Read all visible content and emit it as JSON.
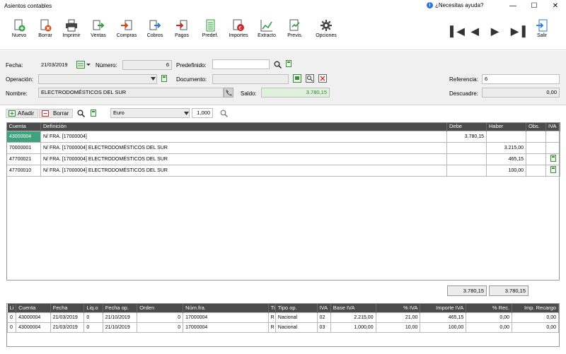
{
  "window": {
    "title": "Asientos contables",
    "help": "¿Necesitas ayuda?"
  },
  "toolbar": [
    {
      "label": "Nuevo",
      "icon": "new-doc-icon"
    },
    {
      "label": "Borrar",
      "icon": "delete-doc-icon"
    },
    {
      "label": "Imprimir",
      "icon": "printer-icon"
    },
    {
      "label": "Ventas",
      "icon": "sales-icon"
    },
    {
      "label": "Compras",
      "icon": "purchases-icon"
    },
    {
      "label": "Cobros",
      "icon": "collections-icon"
    },
    {
      "label": "Pagos",
      "icon": "payments-icon"
    },
    {
      "label": "Predef.",
      "icon": "predefined-icon"
    },
    {
      "label": "Importes",
      "icon": "amounts-icon"
    },
    {
      "label": "Extracto",
      "icon": "statement-chart-icon"
    },
    {
      "label": "Previs.",
      "icon": "forecast-icon"
    },
    {
      "label": "Opciones",
      "icon": "gear-icon"
    }
  ],
  "salir": "Salir",
  "form": {
    "fecha_label": "Fecha:",
    "fecha": "21/03/2019",
    "numero_label": "Número:",
    "numero": "6",
    "predefinido_label": "Predefinido:",
    "predefinido": "",
    "operacion_label": "Operación:",
    "operacion": "",
    "documento_label": "Documento:",
    "documento": "",
    "nombre_label": "Nombre:",
    "nombre": "ELECTRODOMÉSTICOS DEL SUR",
    "saldo_label": "Saldo:",
    "saldo": "3.780,15",
    "referencia_label": "Referencia:",
    "referencia": "6",
    "descuadre_label": "Descuadre:",
    "descuadre": "0,00"
  },
  "gridtools": {
    "add": "Añadir",
    "delete": "Borrar",
    "currency": "Euro",
    "rate": "1,000"
  },
  "grid1": {
    "headers": [
      "Cuenta",
      "Definición",
      "Debe",
      "Haber",
      "Obs.",
      "IVA"
    ],
    "rows": [
      {
        "cuenta": "43000004",
        "def": "N/ FRA. [17000004]",
        "debe": "3.780,15",
        "haber": "",
        "iva": false
      },
      {
        "cuenta": "70000001",
        "def": "N/ FRA. [17000004] ELECTRODOMÉSTICOS DEL SUR",
        "debe": "",
        "haber": "3.215,00",
        "iva": false
      },
      {
        "cuenta": "47700021",
        "def": "N/ FRA. [17000004] ELECTRODOMÉSTICOS DEL SUR",
        "debe": "",
        "haber": "465,15",
        "iva": true
      },
      {
        "cuenta": "47700010",
        "def": "N/ FRA. [17000004] ELECTRODOMÉSTICOS DEL SUR",
        "debe": "",
        "haber": "100,00",
        "iva": true
      }
    ],
    "total_debe": "3.780,15",
    "total_haber": "3.780,15"
  },
  "grid2": {
    "headers": [
      "Li",
      "Cuenta",
      "Fecha",
      "Liq.o",
      "Fecha op.",
      "Orden",
      "Núm.fra.",
      "Ti",
      "Tipo op.",
      "IVA",
      "Base IVA",
      "% IVA",
      "Importe IVA",
      "% Rec.",
      "Imp. Recargo"
    ],
    "rows": [
      [
        "0",
        "43000004",
        "21/03/2019",
        "0",
        "21/10/2019",
        "0",
        "17000004",
        "R",
        "Nacional",
        "02",
        "2.215,00",
        "21,00",
        "465,15",
        "0,00",
        "0,00"
      ],
      [
        "0",
        "43000004",
        "21/03/2019",
        "0",
        "21/10/2019",
        "0",
        "17000004",
        "R",
        "Nacional",
        "03",
        "1.000,00",
        "10,00",
        "100,00",
        "0,00",
        "0,00"
      ]
    ]
  }
}
